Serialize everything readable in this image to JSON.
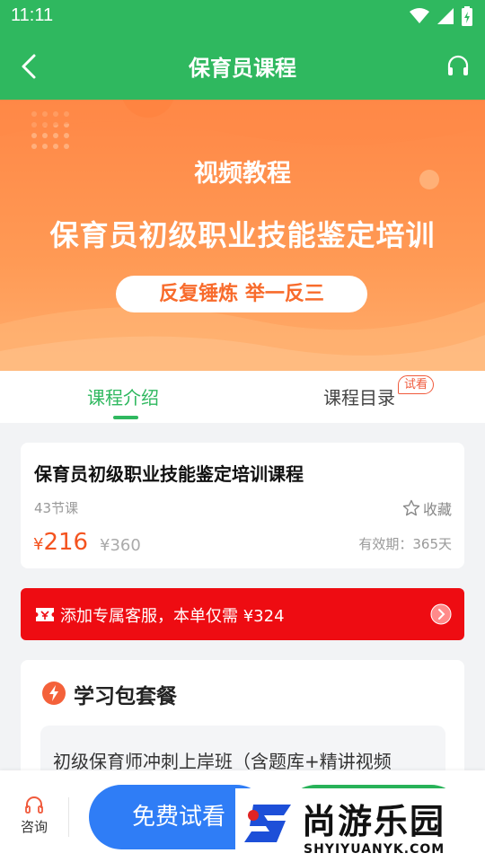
{
  "status_bar": {
    "time": "11:11"
  },
  "header": {
    "title": "保育员课程",
    "back_icon": "chevron-left-icon",
    "service_icon": "headset-icon"
  },
  "banner": {
    "subtitle": "视频教程",
    "title": "保育员初级职业技能鉴定培训",
    "slogan": "反复锤炼 举一反三"
  },
  "tabs": {
    "items": [
      {
        "label": "课程介绍",
        "active": true
      },
      {
        "label": "课程目录",
        "active": false,
        "badge": "试看"
      }
    ]
  },
  "course": {
    "name": "保育员初级职业技能鉴定培训课程",
    "lessons": "43节课",
    "favorite_label": "收藏",
    "currency": "¥",
    "price": "216",
    "original_price": "¥360",
    "validity": "有效期：365天"
  },
  "promo": {
    "text": "添加专属客服，本单仅需 ¥324"
  },
  "package": {
    "title": "学习包套餐",
    "items": [
      {
        "name": "初级保育师冲刺上岸班（含题库+精讲视频"
      }
    ]
  },
  "bottom_bar": {
    "consult_label": "咨询",
    "free_trial_label": "免费试看"
  },
  "watermark": {
    "text": "尚游乐园",
    "url": "SHYIYUANYK.COM"
  },
  "colors": {
    "brand_green": "#2fb85f",
    "price_orange": "#f4531f",
    "promo_red": "#ee0c12",
    "trial_blue": "#2f7df6"
  }
}
